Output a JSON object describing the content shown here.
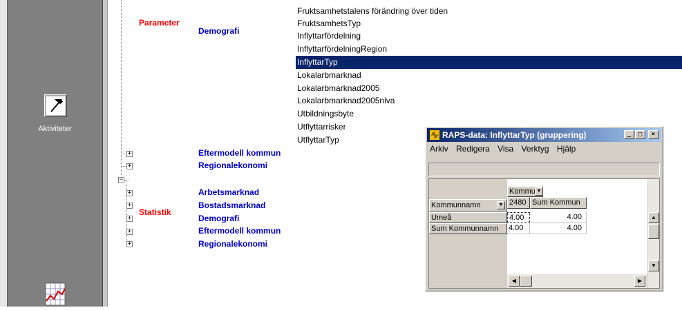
{
  "sidebar": {
    "activities_label": "Aktiviteter",
    "activities_icon": "hammer-icon",
    "chart_icon": "line-chart-icon"
  },
  "tree": {
    "parameter": {
      "label": "Parameter",
      "demografi": "Demografi",
      "items": [
        "Fruktsamhetstalens förändring över tiden",
        "FruktsamhetsTyp",
        "Inflyttarfördelning",
        "InflyttarfördelningRegion",
        "InflyttarTyp",
        "Lokalarbmarknad",
        "Lokalarbmarknad2005",
        "Lokalarbmarknad2005niva",
        "Utbildningsbyte",
        "Utflyttarrisker",
        "UtflyttarTyp"
      ],
      "selected_index": 4,
      "eftermodell": "Eftermodell kommun",
      "regionalekonomi": "Regionalekonomi"
    },
    "statistik": {
      "label": "Statistik",
      "items": [
        "Arbetsmarknad",
        "Bostadsmarknad",
        "Demografi",
        "Eftermodell kommun",
        "Regionalekonomi"
      ]
    }
  },
  "dialog": {
    "title": "RAPS-data: InflyttarTyp (gruppering)",
    "minimize": "_",
    "maximize": "□",
    "close": "×",
    "menu": [
      "Arkiv",
      "Redigera",
      "Visa",
      "Verktyg",
      "Hjälp"
    ],
    "pivot": {
      "column_field": "Kommun",
      "row_field": "Kommunnamn",
      "column_headers": [
        "2480",
        "Sum Kommun"
      ],
      "rows": [
        {
          "label": "Umeå",
          "values": [
            "4.00",
            "4.00"
          ]
        },
        {
          "label": "Sum Kommunnamn",
          "values": [
            "4.00",
            "4.00"
          ]
        }
      ]
    }
  }
}
